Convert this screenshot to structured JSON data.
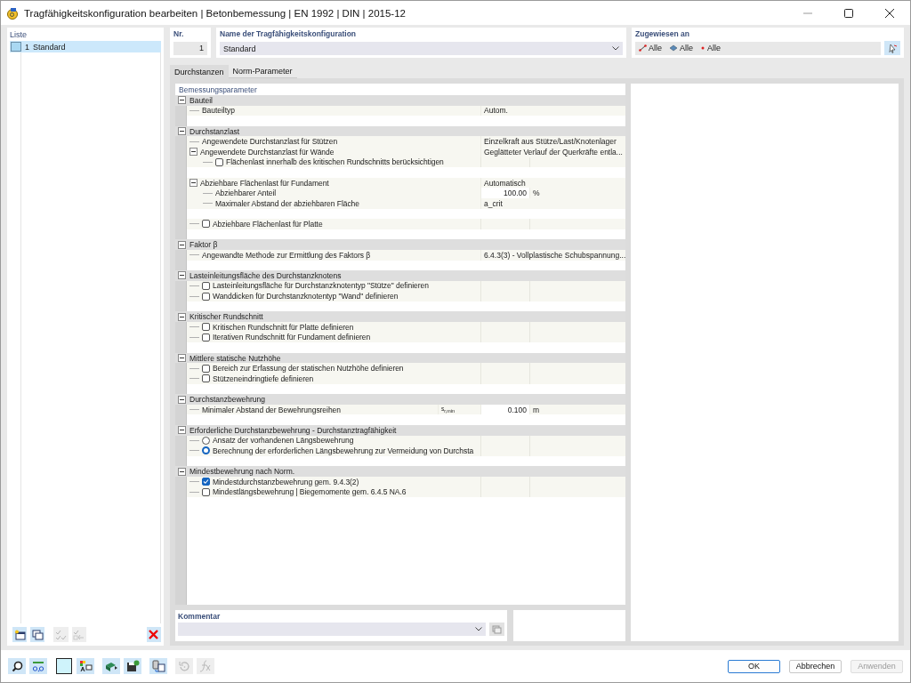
{
  "window": {
    "title": "Tragfähigkeitskonfiguration bearbeiten | Betonbemessung | EN 1992 | DIN | 2015-12"
  },
  "list": {
    "title": "Liste",
    "items": [
      {
        "number": "1",
        "name": "Standard",
        "selected": true,
        "color": "#a9d8f2"
      }
    ],
    "tools": [
      {
        "kind": "new",
        "disabled": false
      },
      {
        "kind": "copy",
        "disabled": false
      },
      {
        "kind": "check",
        "disabled": true
      },
      {
        "kind": "uncheck",
        "disabled": true
      },
      {
        "kind": "delete",
        "disabled": false
      }
    ]
  },
  "header": {
    "number_label": "Nr.",
    "number": "1",
    "name_label": "Name der Tragfähigkeitskonfiguration",
    "name": "Standard",
    "assigned_label": "Zugewiesen an",
    "assigned": [
      {
        "kind": "members",
        "text": "Alle"
      },
      {
        "kind": "surfaces",
        "text": "Alle"
      },
      {
        "kind": "nodes",
        "text": "Alle"
      }
    ]
  },
  "tabs": [
    {
      "label": "Durchstanzen",
      "selected": true
    },
    {
      "label": "Norm-Parameter",
      "selected": false
    }
  ],
  "parameters": {
    "title": "Bemessungsparameter",
    "sections": [
      {
        "title": "Bauteil",
        "expanded": true,
        "rows": [
          {
            "kind": "value",
            "label": "Bauteiltyp",
            "value": "Autom."
          }
        ]
      },
      {
        "title": "Durchstanzlast",
        "expanded": true,
        "rows": [
          {
            "kind": "value",
            "label": "Angewendete Durchstanzlast für Stützen",
            "value": "Einzelkraft aus Stütze/Last/Knotenlager"
          },
          {
            "kind": "value",
            "label": "Angewendete Durchstanzlast für Wände",
            "value": "Geglätteter Verlauf der Querkräfte entla...",
            "expanded": true,
            "children": [
              {
                "kind": "checkbox",
                "label": "Flächenlast innerhalb des kritischen Rundschnitts berücksichtigen",
                "checked": false
              }
            ]
          },
          {
            "kind": "spacer"
          },
          {
            "kind": "value",
            "label": "Abziehbare Flächenlast für Fundament",
            "value": "Automatisch",
            "expanded": true,
            "children": [
              {
                "kind": "value",
                "label": "Abziehbarer Anteil",
                "value": "100.00",
                "unit": "%"
              },
              {
                "kind": "value",
                "label": "Maximaler Abstand der abziehbaren Fläche",
                "value": "a_crit"
              }
            ]
          },
          {
            "kind": "spacer"
          },
          {
            "kind": "checkbox",
            "label": "Abziehbare Flächenlast für Platte",
            "checked": false
          }
        ]
      },
      {
        "title": "Faktor β",
        "expanded": true,
        "rows": [
          {
            "kind": "value",
            "label": "Angewandte Methode zur Ermittlung des Faktors β",
            "value": "6.4.3(3) - Vollplastische Schubspannung..."
          }
        ]
      },
      {
        "title": "Lasteinleitungsfläche des Durchstanzknotens",
        "expanded": true,
        "rows": [
          {
            "kind": "checkbox",
            "label": "Lasteinleitungsfläche für Durchstanzknotentyp \"Stütze\" definieren",
            "checked": false
          },
          {
            "kind": "checkbox",
            "label": "Wanddicken für Durchstanzknotentyp \"Wand\" definieren",
            "checked": false
          }
        ]
      },
      {
        "title": "Kritischer Rundschnitt",
        "expanded": true,
        "rows": [
          {
            "kind": "checkbox",
            "label": "Kritischen Rundschnitt für Platte definieren",
            "checked": false
          },
          {
            "kind": "checkbox",
            "label": "Iterativen Rundschnitt für Fundament definieren",
            "checked": false
          }
        ]
      },
      {
        "title": "Mittlere statische Nutzhöhe",
        "expanded": true,
        "rows": [
          {
            "kind": "checkbox",
            "label": "Bereich zur Erfassung der statischen Nutzhöhe definieren",
            "checked": false
          },
          {
            "kind": "checkbox",
            "label": "Stützeneindringtiefe definieren",
            "checked": false
          }
        ]
      },
      {
        "title": "Durchstanzbewehrung",
        "expanded": true,
        "rows": [
          {
            "kind": "value",
            "label": "Minimaler Abstand der Bewehrungsreihen",
            "symbol": "s$_{r,min}$",
            "value": "0.100",
            "unit": "m"
          }
        ]
      },
      {
        "title": "Erforderliche Durchstanzbewehrung - Durchstanztragfähigkeit",
        "expanded": true,
        "rows": [
          {
            "kind": "radio",
            "label": "Ansatz der vorhandenen Längsbewehrung",
            "selected": false
          },
          {
            "kind": "radio",
            "label": "Berechnung der erforderlichen Längsbewehrung zur Vermeidung von Durchsta",
            "selected": true
          }
        ]
      },
      {
        "title": "Mindestbewehrung nach Norm.",
        "expanded": true,
        "rows": [
          {
            "kind": "checkbox",
            "label": "Mindestdurchstanzbewehrung gem. 9.4.3(2)",
            "checked": true
          },
          {
            "kind": "checkbox",
            "label": "Mindestlängsbewehrung | Biegemomente gem. 6.4.5 NA.6",
            "checked": false
          }
        ]
      }
    ]
  },
  "comment": {
    "label": "Kommentar"
  },
  "toolbar": [
    {
      "kind": "search",
      "disabled": false
    },
    {
      "kind": "decimals",
      "disabled": false
    },
    {
      "kind": "color",
      "disabled": false
    },
    {
      "kind": "legend",
      "disabled": false
    },
    {
      "kind": "export",
      "disabled": false
    },
    {
      "kind": "save",
      "disabled": false
    },
    {
      "kind": "copy",
      "disabled": false
    },
    {
      "kind": "reset",
      "disabled": true
    },
    {
      "kind": "formula",
      "disabled": true
    }
  ],
  "buttons": [
    {
      "label": "OK",
      "default": true,
      "disabled": false
    },
    {
      "label": "Abbrechen",
      "default": false,
      "disabled": false
    },
    {
      "label": "Anwenden",
      "default": false,
      "disabled": true
    }
  ]
}
